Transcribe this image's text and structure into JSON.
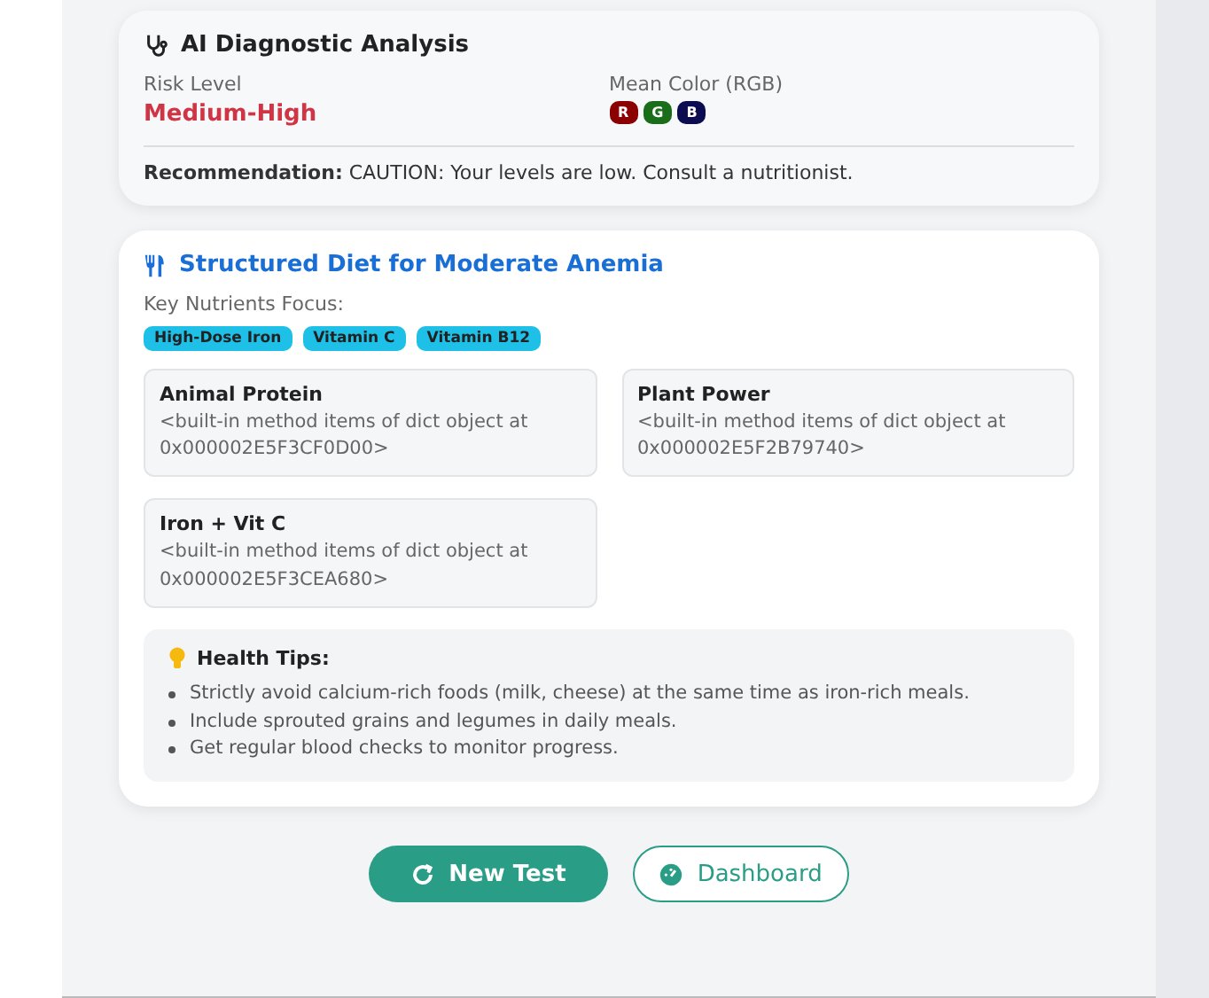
{
  "analysis": {
    "title": "AI Diagnostic Analysis",
    "risk_label": "Risk Level",
    "risk_value": "Medium-High",
    "color_label": "Mean Color (RGB)",
    "channels": [
      {
        "label": "R",
        "color": "#8b0000"
      },
      {
        "label": "G",
        "color": "#1a6e1a"
      },
      {
        "label": "B",
        "color": "#0c0c50"
      }
    ],
    "recommendation": "**Recommendation:** CAUTION: Your levels are low. Consult a nutritionist."
  },
  "diet": {
    "title": "Structured Diet for Moderate Anemia",
    "nutrients_label": "Key Nutrients Focus:",
    "nutrients": [
      "High-Dose Iron",
      "Vitamin C",
      "Vitamin B12"
    ],
    "groups": [
      {
        "title": "Animal Protein",
        "text": "<built-in method items of dict object at 0x000002E5F3CF0D00>"
      },
      {
        "title": "Plant Power",
        "text": "<built-in method items of dict object at 0x000002E5F2B79740>"
      },
      {
        "title": "Iron + Vit C",
        "text": "<built-in method items of dict object at 0x000002E5F3CEA680>"
      }
    ],
    "tips_title": "Health Tips:",
    "tips": [
      "Strictly avoid calcium-rich foods (milk, cheese) at the same time as iron-rich meals.",
      "Include sprouted grains and legumes in daily meals.",
      "Get regular blood checks to monitor progress."
    ]
  },
  "buttons": [
    {
      "label": "New Test",
      "kind": "primary"
    },
    {
      "label": "Dashboard",
      "kind": "outline"
    }
  ]
}
